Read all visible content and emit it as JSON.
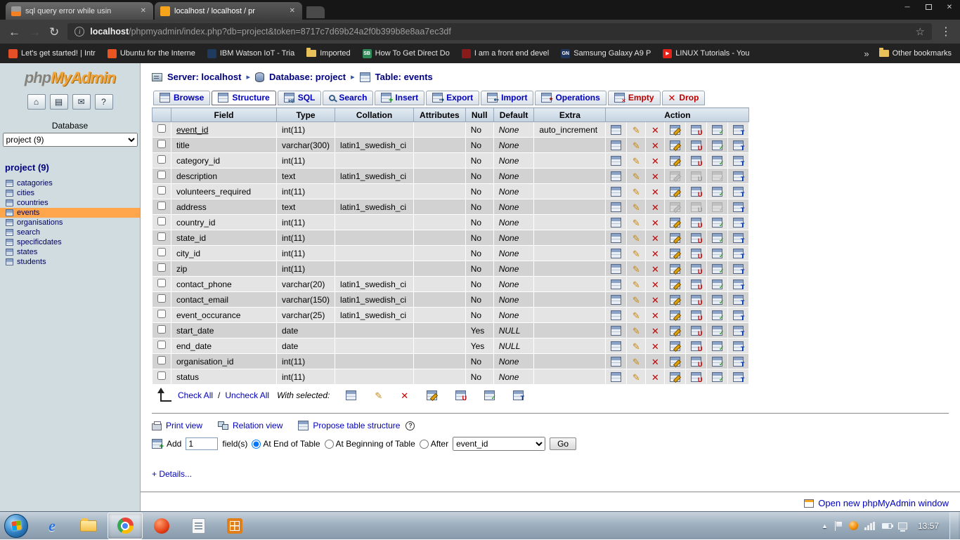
{
  "colors": {
    "pma_link": "#0000bb",
    "danger_red": "#bb0000",
    "row_even": "#e4e4e4",
    "row_odd": "#d2d2d2",
    "table_header_bg": "#c3d2e0",
    "sidebar_bg": "#d0dce0",
    "selected_table_highlight": "#ffa64d",
    "logo_orange": "#f2a33a"
  },
  "browser": {
    "tabs": [
      {
        "title": "sql query error while usin",
        "active": false
      },
      {
        "title": "localhost / localhost / pr",
        "active": true
      }
    ],
    "url_host": "localhost",
    "url_rest": "/phpmyadmin/index.php?db=project&token=8717c7d69b24a2f0b399b8e8aa7ec3df",
    "bookmarks": [
      {
        "label": "Let's get started! | Intr",
        "color": "#e34f26",
        "glyph": ""
      },
      {
        "label": "Ubuntu for the Interne",
        "color": "#e95420",
        "glyph": ""
      },
      {
        "label": "IBM Watson IoT - Tria",
        "color": "#1f3a5f",
        "glyph": ""
      },
      {
        "label": "Imported",
        "color": "#e8c15a",
        "glyph": "",
        "folder": true
      },
      {
        "label": "How To Get Direct Do",
        "color": "#2e8b57",
        "glyph": "SB"
      },
      {
        "label": "I am a front end devel",
        "color": "#8b1a1a",
        "glyph": ""
      },
      {
        "label": "Samsung Galaxy A9 P",
        "color": "#20365c",
        "glyph": "GN"
      },
      {
        "label": "LINUX Tutorials - You",
        "color": "#e62117",
        "glyph": "▶"
      }
    ],
    "bookmarks_overflow": "»",
    "other_bookmarks": "Other bookmarks"
  },
  "sidebar": {
    "logo_php": "php",
    "logo_rest": "MyAdmin",
    "database_label": "Database",
    "db_select": "project (9)",
    "db_link": "project (9)",
    "tables": [
      "catagories",
      "cities",
      "countries",
      "events",
      "organisations",
      "search",
      "specificdates",
      "states",
      "students"
    ],
    "selected_table": "events"
  },
  "pma": {
    "breadcrumb": {
      "server": "Server: localhost",
      "database": "Database: project",
      "table": "Table: events"
    },
    "tabs": [
      {
        "label": "Browse",
        "icon": "browse-icon"
      },
      {
        "label": "Structure",
        "icon": "structure-icon",
        "active": true
      },
      {
        "label": "SQL",
        "icon": "sql-icon"
      },
      {
        "label": "Search",
        "icon": "search-icon"
      },
      {
        "label": "Insert",
        "icon": "insert-icon"
      },
      {
        "label": "Export",
        "icon": "export-icon"
      },
      {
        "label": "Import",
        "icon": "import-icon"
      },
      {
        "label": "Operations",
        "icon": "operations-icon"
      },
      {
        "label": "Empty",
        "icon": "empty-icon",
        "danger": true
      },
      {
        "label": "Drop",
        "icon": "drop-icon",
        "danger": true
      }
    ],
    "table": {
      "headers": [
        "Field",
        "Type",
        "Collation",
        "Attributes",
        "Null",
        "Default",
        "Extra",
        "Action"
      ],
      "action_icons": [
        "browse-icon",
        "change-icon",
        "drop-icon",
        "primary-icon",
        "unique-icon",
        "index-icon",
        "fulltext-icon"
      ],
      "rows": [
        {
          "field": "event_id",
          "type": "int(11)",
          "collation": "",
          "attributes": "",
          "null": "No",
          "default": "None",
          "extra": "auto_increment",
          "primary": true
        },
        {
          "field": "title",
          "type": "varchar(300)",
          "collation": "latin1_swedish_ci",
          "attributes": "",
          "null": "No",
          "default": "None",
          "extra": ""
        },
        {
          "field": "category_id",
          "type": "int(11)",
          "collation": "",
          "attributes": "",
          "null": "No",
          "default": "None",
          "extra": ""
        },
        {
          "field": "description",
          "type": "text",
          "collation": "latin1_swedish_ci",
          "attributes": "",
          "null": "No",
          "default": "None",
          "extra": "",
          "text_type": true
        },
        {
          "field": "volunteers_required",
          "type": "int(11)",
          "collation": "",
          "attributes": "",
          "null": "No",
          "default": "None",
          "extra": ""
        },
        {
          "field": "address",
          "type": "text",
          "collation": "latin1_swedish_ci",
          "attributes": "",
          "null": "No",
          "default": "None",
          "extra": "",
          "text_type": true
        },
        {
          "field": "country_id",
          "type": "int(11)",
          "collation": "",
          "attributes": "",
          "null": "No",
          "default": "None",
          "extra": ""
        },
        {
          "field": "state_id",
          "type": "int(11)",
          "collation": "",
          "attributes": "",
          "null": "No",
          "default": "None",
          "extra": ""
        },
        {
          "field": "city_id",
          "type": "int(11)",
          "collation": "",
          "attributes": "",
          "null": "No",
          "default": "None",
          "extra": ""
        },
        {
          "field": "zip",
          "type": "int(11)",
          "collation": "",
          "attributes": "",
          "null": "No",
          "default": "None",
          "extra": ""
        },
        {
          "field": "contact_phone",
          "type": "varchar(20)",
          "collation": "latin1_swedish_ci",
          "attributes": "",
          "null": "No",
          "default": "None",
          "extra": ""
        },
        {
          "field": "contact_email",
          "type": "varchar(150)",
          "collation": "latin1_swedish_ci",
          "attributes": "",
          "null": "No",
          "default": "None",
          "extra": ""
        },
        {
          "field": "event_occurance",
          "type": "varchar(25)",
          "collation": "latin1_swedish_ci",
          "attributes": "",
          "null": "No",
          "default": "None",
          "extra": ""
        },
        {
          "field": "start_date",
          "type": "date",
          "collation": "",
          "attributes": "",
          "null": "Yes",
          "default": "NULL",
          "extra": ""
        },
        {
          "field": "end_date",
          "type": "date",
          "collation": "",
          "attributes": "",
          "null": "Yes",
          "default": "NULL",
          "extra": ""
        },
        {
          "field": "organisation_id",
          "type": "int(11)",
          "collation": "",
          "attributes": "",
          "null": "No",
          "default": "None",
          "extra": ""
        },
        {
          "field": "status",
          "type": "int(11)",
          "collation": "",
          "attributes": "",
          "null": "No",
          "default": "None",
          "extra": ""
        }
      ]
    },
    "check_all": "Check All",
    "check_uncheck_separator": "/",
    "uncheck_all": "Uncheck All",
    "with_selected": "With selected:",
    "links": {
      "print_view": "Print view",
      "relation_view": "Relation view",
      "propose": "Propose table structure"
    },
    "add": {
      "add_label": "Add",
      "count": "1",
      "fields_label": "field(s)",
      "end": "At End of Table",
      "beginning": "At Beginning of Table",
      "after": "After",
      "after_value": "event_id",
      "go": "Go"
    },
    "details": "+ Details...",
    "open_new_window": "Open new phpMyAdmin window"
  },
  "taskbar": {
    "time": "13:57"
  }
}
